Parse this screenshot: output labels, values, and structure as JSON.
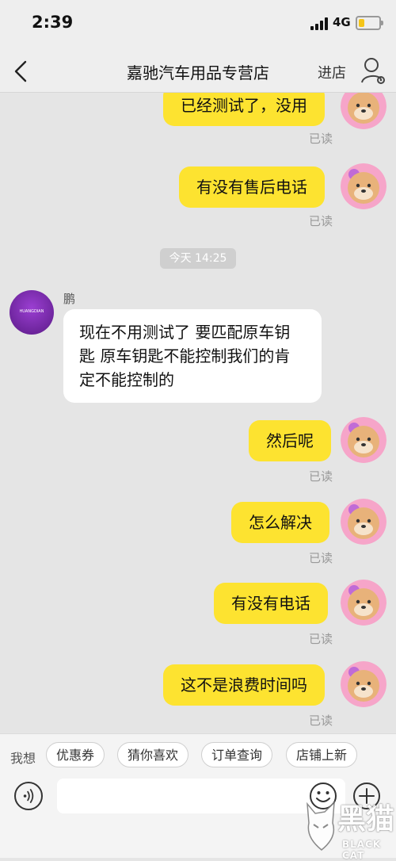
{
  "status": {
    "time": "2:39",
    "network": "4G",
    "battery_level": 0.3,
    "battery_color": "#f5c518"
  },
  "nav": {
    "back_icon": "chevron-left-icon",
    "title": "嘉驰汽车用品专营店",
    "enter_store": "进店",
    "user_icon": "user-settings-icon"
  },
  "chat": {
    "timestamp": "今天 14:25",
    "sender_name": "鹏",
    "shop_avatar_brand": "HUANGDIAN",
    "messages": [
      {
        "from": "me",
        "text": "已经测试了，没用",
        "status": "已读"
      },
      {
        "from": "me",
        "text": "有没有售后电话",
        "status": "已读"
      },
      {
        "from": "shop",
        "text": "现在不用测试了  要匹配原车钥匙  原车钥匙不能控制我们的肯定不能控制的"
      },
      {
        "from": "me",
        "text": "然后呢",
        "status": "已读"
      },
      {
        "from": "me",
        "text": "怎么解决",
        "status": "已读"
      },
      {
        "from": "me",
        "text": "有没有电话",
        "status": "已读"
      },
      {
        "from": "me",
        "text": "这不是浪费时间吗",
        "status": "已读"
      }
    ],
    "my_bubble_color": "#fde330"
  },
  "quick": {
    "label": "我想",
    "chips": [
      "优惠券",
      "猜你喜欢",
      "订单查询",
      "店铺上新"
    ]
  },
  "input": {
    "placeholder": "",
    "voice_icon": "voice-icon",
    "emoji_icon": "emoji-icon",
    "plus_icon": "plus-icon"
  },
  "watermark": {
    "cn": "黑猫",
    "en": "BLACK CAT"
  }
}
